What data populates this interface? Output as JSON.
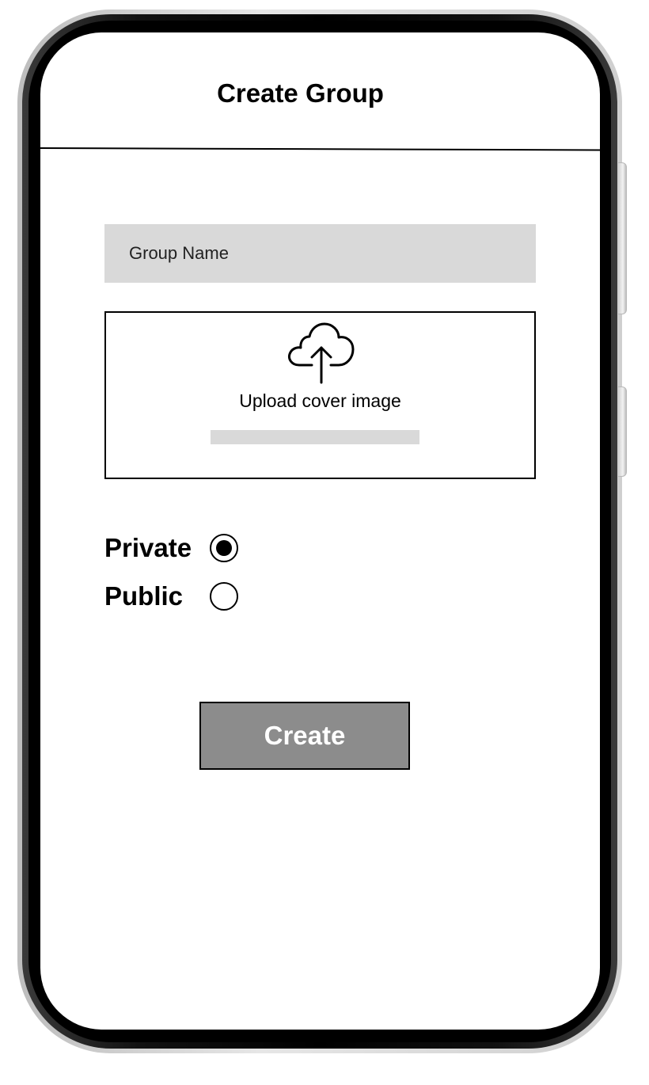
{
  "header": {
    "title": "Create Group"
  },
  "form": {
    "group_name": {
      "value": "",
      "placeholder": "Group Name"
    },
    "upload": {
      "icon": "cloud-upload-icon",
      "label": "Upload cover image",
      "progress": 0
    },
    "visibility": {
      "options": [
        {
          "label": "Private",
          "selected": true
        },
        {
          "label": "Public",
          "selected": false
        }
      ]
    },
    "submit_label": "Create"
  },
  "colors": {
    "input_bg": "#d9d9d9",
    "button_bg": "#8c8c8c",
    "button_text": "#ffffff",
    "text": "#000000"
  }
}
